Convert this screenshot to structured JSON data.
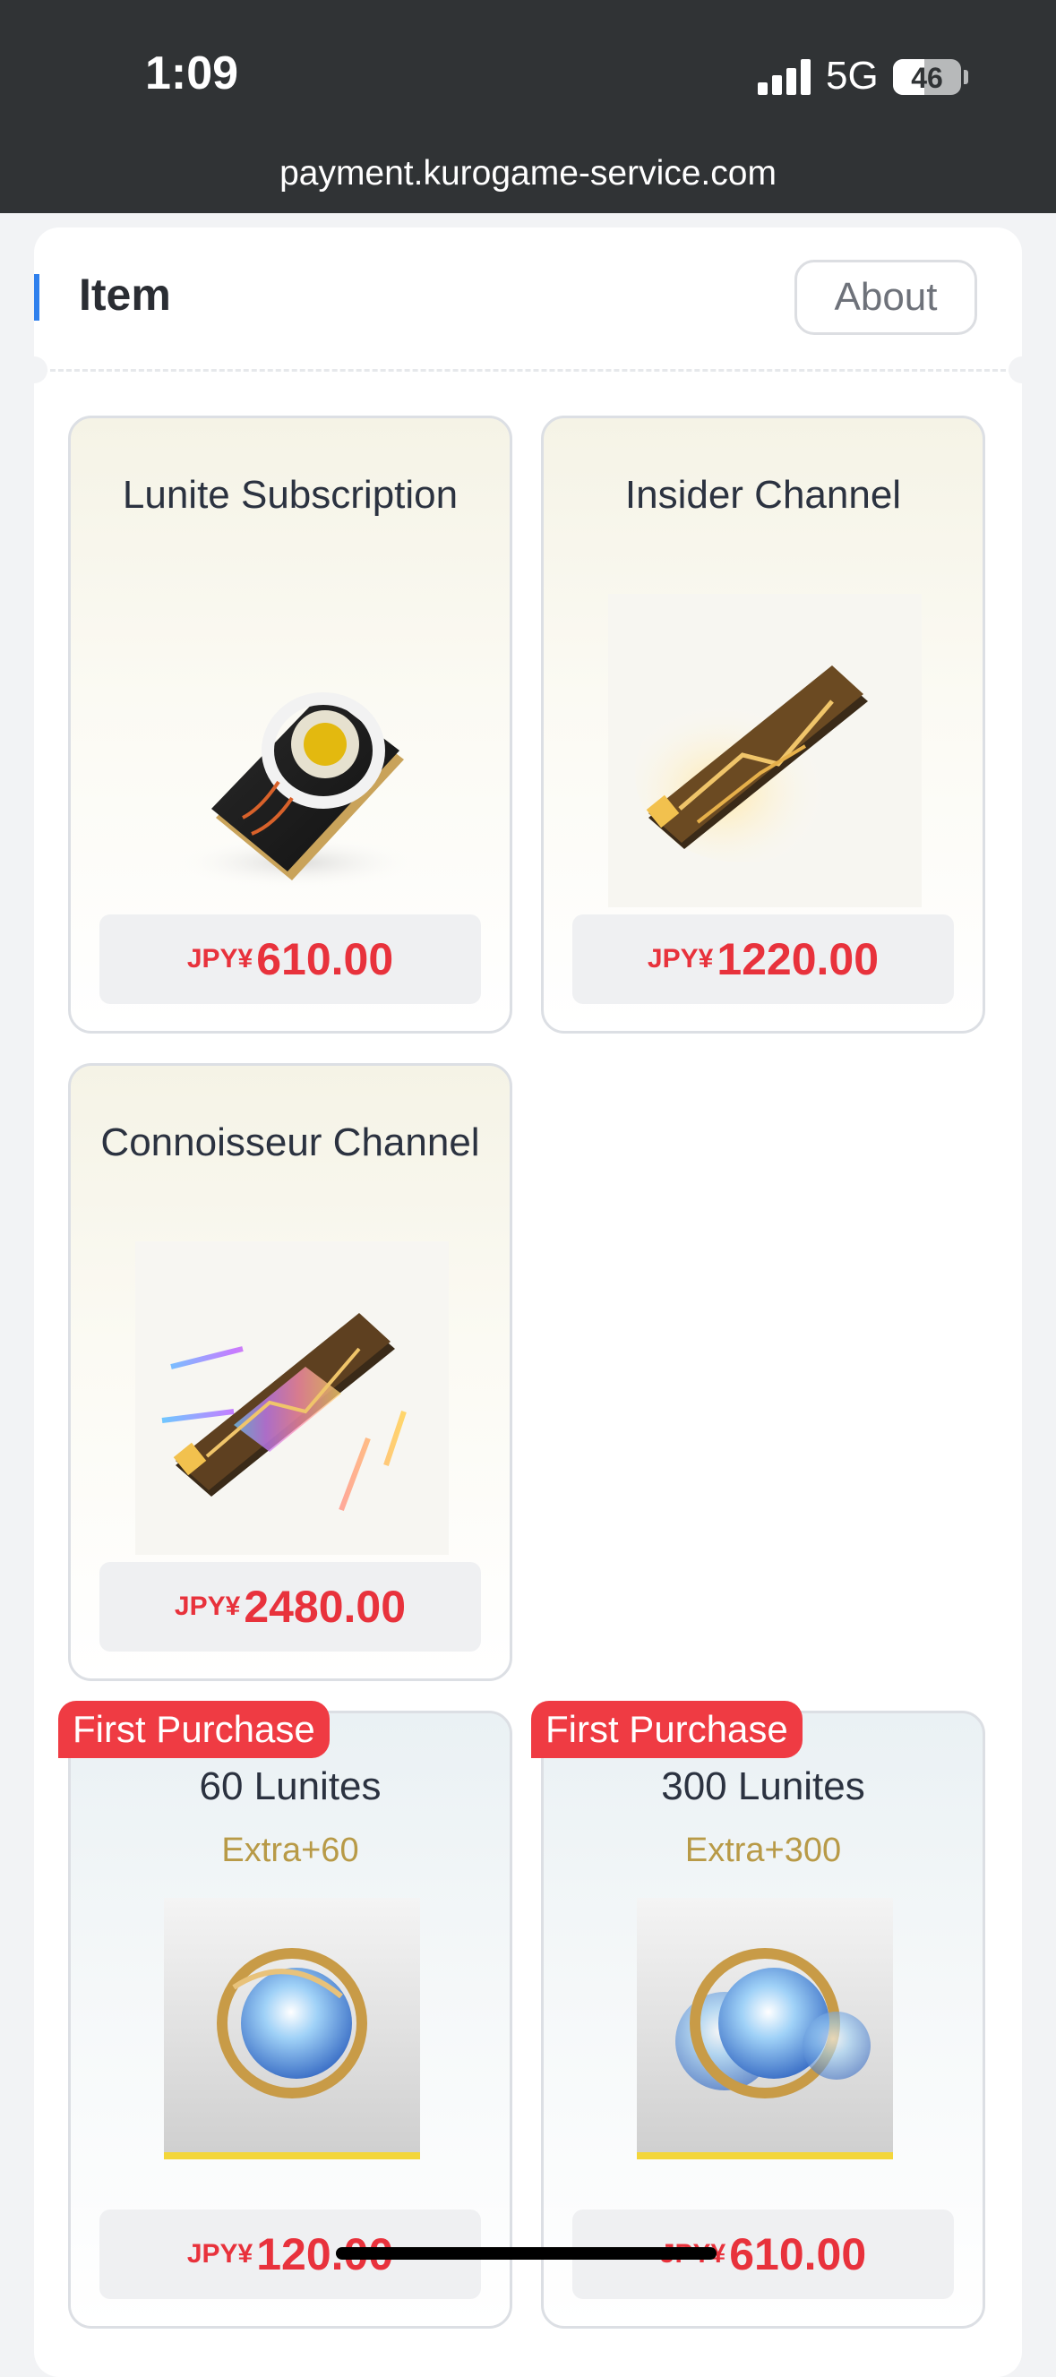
{
  "status_bar": {
    "time": "1:09",
    "network": "5G",
    "battery": "46",
    "battery_level": 0.46
  },
  "browser": {
    "url": "payment.kurogame-service.com"
  },
  "header": {
    "title": "Item",
    "about_label": "About"
  },
  "products": [
    {
      "title": "Lunite Subscription",
      "currency": "JPY¥",
      "amount": "610.00",
      "image": "lunite-card-icon"
    },
    {
      "title": "Insider Channel",
      "currency": "JPY¥",
      "amount": "1220.00",
      "image": "gold-chip-icon"
    },
    {
      "title": "Connoisseur Channel",
      "currency": "JPY¥",
      "amount": "2480.00",
      "image": "rainbow-chip-icon"
    },
    {
      "title": "60 Lunites",
      "tag": "First Purchase",
      "extra": "Extra+60",
      "currency": "JPY¥",
      "amount": "120.00",
      "image": "lunite-orb-icon"
    },
    {
      "title": "300 Lunites",
      "tag": "First Purchase",
      "extra": "Extra+300",
      "currency": "JPY¥",
      "amount": "610.00",
      "image": "lunite-orbs-icon"
    }
  ],
  "colors": {
    "accent": "#2f80ed",
    "price": "#e8323c",
    "tag": "#ef3b43",
    "extra": "#b89a47"
  }
}
